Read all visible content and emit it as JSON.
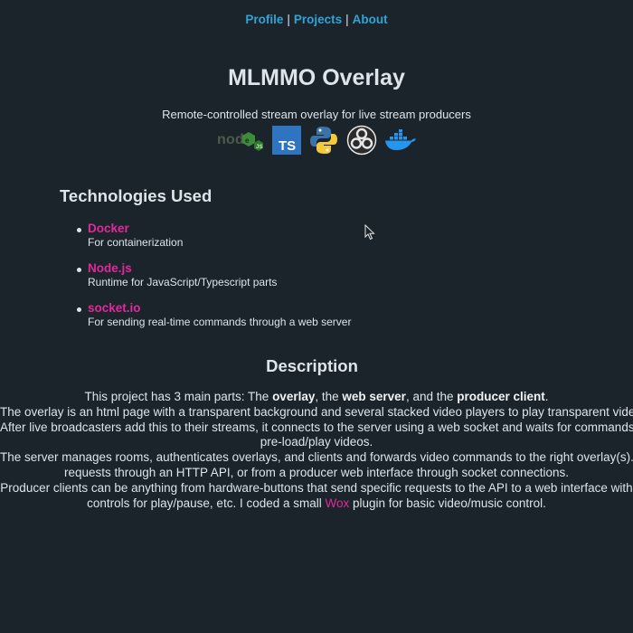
{
  "nav": {
    "items": [
      "Profile",
      "Projects",
      "About"
    ],
    "separator": "|"
  },
  "header": {
    "title": "MLMMO Overlay",
    "subtitle": "Remote-controlled stream overlay for live stream producers"
  },
  "tech_icons": [
    "nodejs-icon",
    "typescript-icon",
    "python-icon",
    "obs-icon",
    "docker-icon"
  ],
  "technologies": {
    "heading": "Technologies Used",
    "items": [
      {
        "name": "Docker",
        "description": "For containerization"
      },
      {
        "name": "Node.js",
        "description": "Runtime for JavaScript/Typescript parts"
      },
      {
        "name": "socket.io",
        "description": "For sending real-time commands through a web server"
      }
    ]
  },
  "description": {
    "heading": "Description",
    "line1": {
      "a": "This project has 3 main parts: The ",
      "b1": "overlay",
      "c": ", the ",
      "b2": "web server",
      "d": ", and the ",
      "b3": "producer client",
      "e": "."
    },
    "line2": "The overlay is an html page with a transparent background and several stacked video players to play transparent videos.",
    "line3": "After live broadcasters add this to their streams, it connects to the server using a web socket and waits for commands to",
    "line4": "pre-load/play videos.",
    "line5": "The server manages rooms, authenticates overlays, and clients and forwards video commands to the right overlay(s). It accepts",
    "line6": "requests through an HTTP API, or from a producer web interface through socket connections.",
    "line7": "Producer clients can be anything from hardware-buttons that send specific requests to the API to a web interface with",
    "line8": {
      "a": "controls for play/pause, etc. I coded a small ",
      "link": "Wox",
      "b": " plugin for basic video/music control."
    }
  },
  "colors": {
    "background": "#1b242b",
    "text": "#dde4ea",
    "nav_link": "#31a3d6",
    "accent": "#e0299b"
  }
}
